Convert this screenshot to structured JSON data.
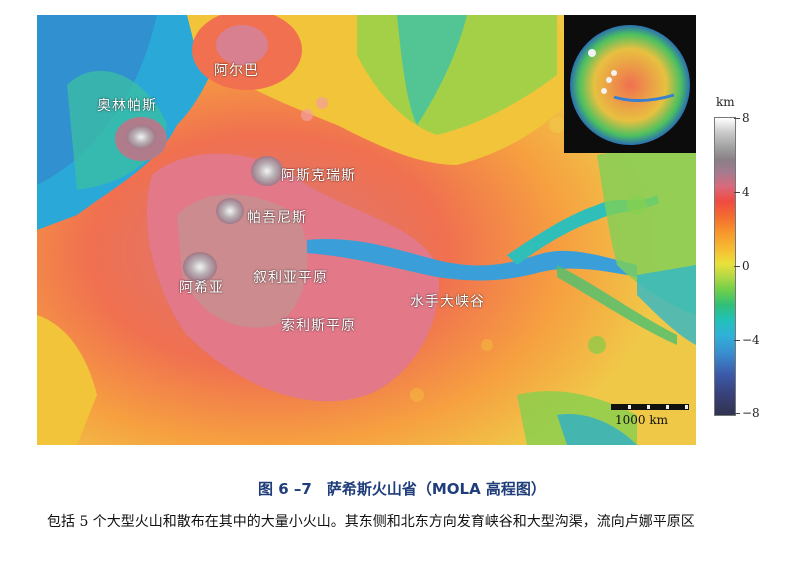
{
  "map": {
    "labels": {
      "olympus": "奥林帕斯",
      "alba": "阿尔巴",
      "ascraeus": "阿斯克瑞斯",
      "pavonis": "帕吾尼斯",
      "arsia": "阿希亚",
      "syria": "叙利亚平原",
      "solis": "索利斯平原",
      "valles": "水手大峡谷"
    },
    "scalebar_label": "1000 km"
  },
  "colorbar": {
    "unit": "km",
    "ticks": [
      "8",
      "4",
      "0",
      "−4",
      "−8"
    ]
  },
  "caption": {
    "title": "图 6 –7　萨希斯火山省（MOLA 高程图）",
    "body": "包括 5 个大型火山和散布在其中的大量小火山。其东侧和北东方向发育峡谷和大型沟渠，流向卢娜平原区"
  }
}
